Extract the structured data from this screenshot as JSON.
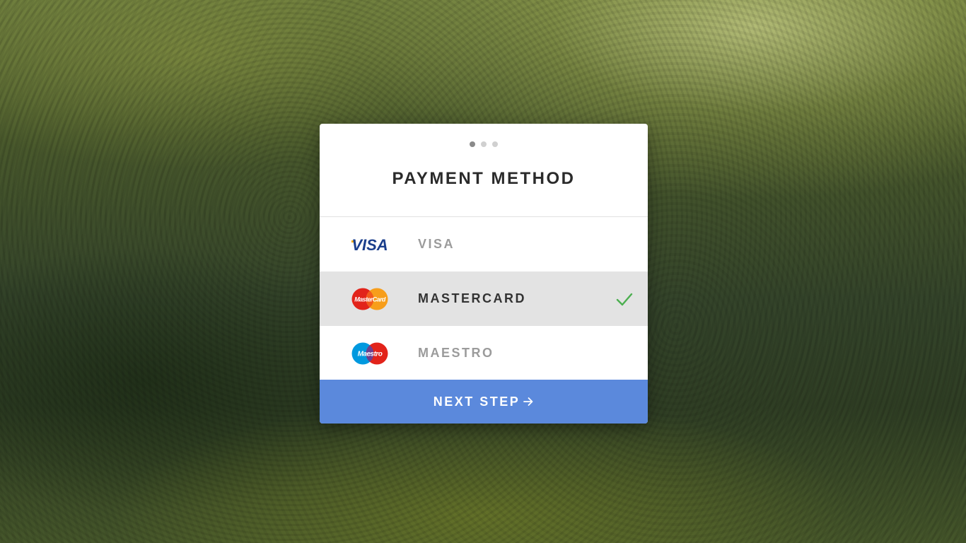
{
  "card": {
    "title": "PAYMENT METHOD",
    "steps": {
      "total": 3,
      "current": 1
    }
  },
  "options": [
    {
      "label": "VISA",
      "logo_text": "VISA",
      "icon": "visa-logo",
      "selected": false
    },
    {
      "label": "MASTERCARD",
      "logo_text": "MasterCard",
      "icon": "mastercard-logo",
      "selected": true
    },
    {
      "label": "MAESTRO",
      "logo_text": "Maestro",
      "icon": "maestro-logo",
      "selected": false
    }
  ],
  "next_button": {
    "label": "NEXT STEP",
    "icon": "arrow-right-icon"
  },
  "colors": {
    "accent": "#5b89dc",
    "check": "#4caf50",
    "selected_bg": "#e3e3e3",
    "visa_blue": "#1a3e8c",
    "visa_gold": "#f2a900",
    "mastercard_red": "#e2231a",
    "mastercard_orange": "#f79e1b",
    "maestro_blue": "#0099df",
    "maestro_red": "#e2231a"
  }
}
